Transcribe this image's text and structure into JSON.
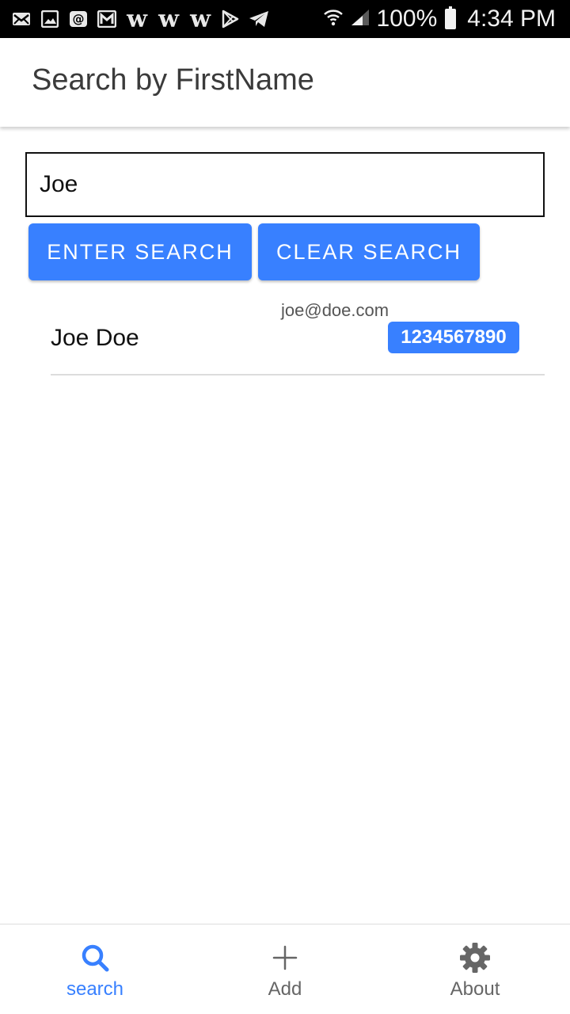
{
  "status_bar": {
    "battery": "100%",
    "time": "4:34 PM",
    "notification_icons": [
      "mail-icon",
      "image-icon",
      "at-sign-icon",
      "gmail-icon",
      "w-icon",
      "w-icon",
      "w-icon",
      "play-store-icon",
      "telegram-icon"
    ],
    "w_letter": "w"
  },
  "appbar": {
    "title": "Search by FirstName"
  },
  "search": {
    "value": "Joe"
  },
  "buttons": {
    "enter": "ENTER SEARCH",
    "clear": "CLEAR SEARCH"
  },
  "results": [
    {
      "email": "joe@doe.com",
      "name": "Joe Doe",
      "phone": "1234567890"
    }
  ],
  "tabs": [
    {
      "label": "search",
      "icon": "search-icon",
      "active": true
    },
    {
      "label": "Add",
      "icon": "plus-icon",
      "active": false
    },
    {
      "label": "About",
      "icon": "gear-icon",
      "active": false
    }
  ],
  "colors": {
    "accent": "#3880ff",
    "tab_inactive": "#666666",
    "status_bar": "#000000"
  }
}
